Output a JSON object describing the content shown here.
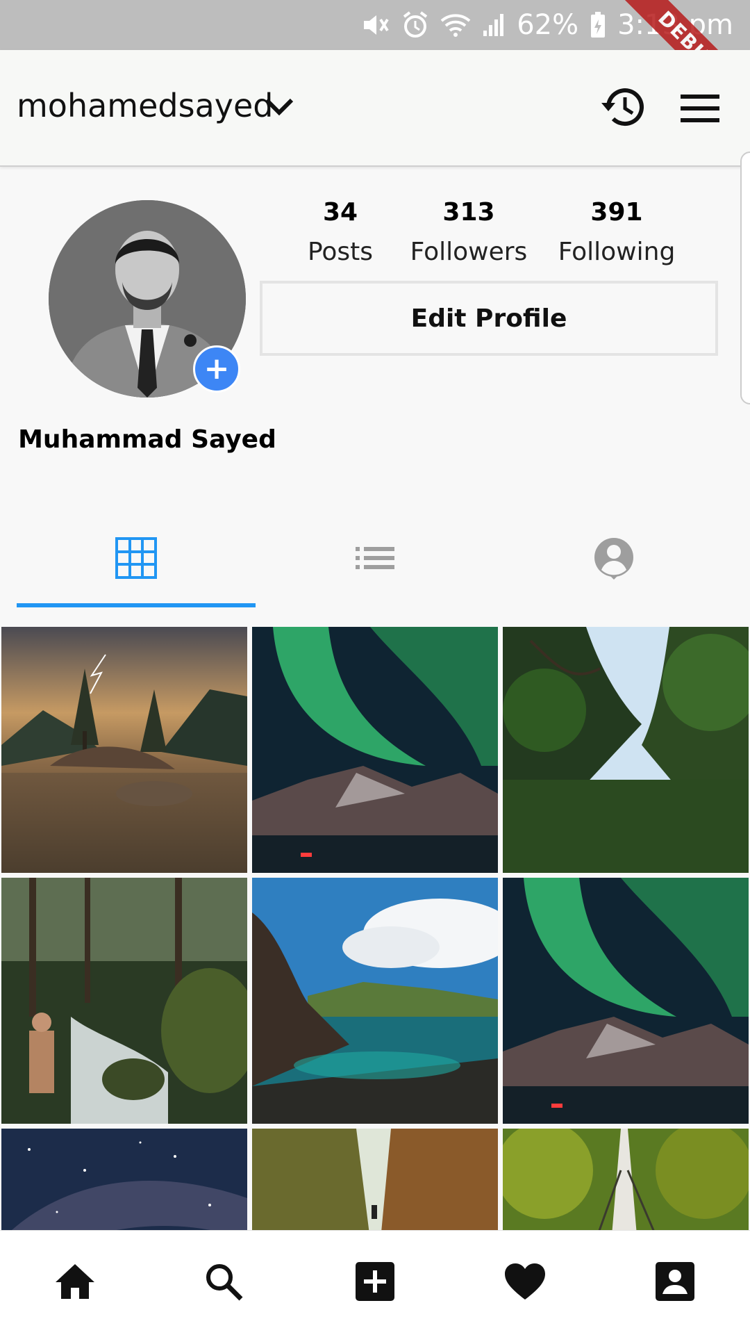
{
  "status_bar": {
    "battery": "62%",
    "time": "3:13 pm"
  },
  "debug_banner": "DEBUG",
  "header": {
    "username": "mohamedsayed"
  },
  "profile": {
    "display_name": "Muhammad Sayed",
    "stats": [
      {
        "value": "34",
        "label": "Posts"
      },
      {
        "value": "313",
        "label": "Followers"
      },
      {
        "value": "391",
        "label": "Following"
      }
    ],
    "edit_button": "Edit Profile"
  },
  "tabs": [
    {
      "name": "grid",
      "icon": "grid-icon",
      "active": true
    },
    {
      "name": "list",
      "icon": "list-icon",
      "active": false
    },
    {
      "name": "tagged",
      "icon": "account-circle-icon",
      "active": false
    }
  ],
  "posts": [
    {
      "scene": "lake-storm-island"
    },
    {
      "scene": "aurora-mountains"
    },
    {
      "scene": "forest-canopy"
    },
    {
      "scene": "jungle-river-hiker"
    },
    {
      "scene": "coastal-lagoon"
    },
    {
      "scene": "aurora-mountains"
    },
    {
      "scene": "milky-way"
    },
    {
      "scene": "railway-forest"
    },
    {
      "scene": "jungle-bridge"
    }
  ],
  "bottom_nav": [
    {
      "name": "home",
      "icon": "home-icon"
    },
    {
      "name": "search",
      "icon": "search-icon"
    },
    {
      "name": "add",
      "icon": "add-box-icon"
    },
    {
      "name": "activity",
      "icon": "heart-icon"
    },
    {
      "name": "profile",
      "icon": "person-box-icon"
    }
  ],
  "colors": {
    "accent": "#2196f3",
    "avatar_add": "#3d86f5",
    "debug": "#b71c1c"
  }
}
